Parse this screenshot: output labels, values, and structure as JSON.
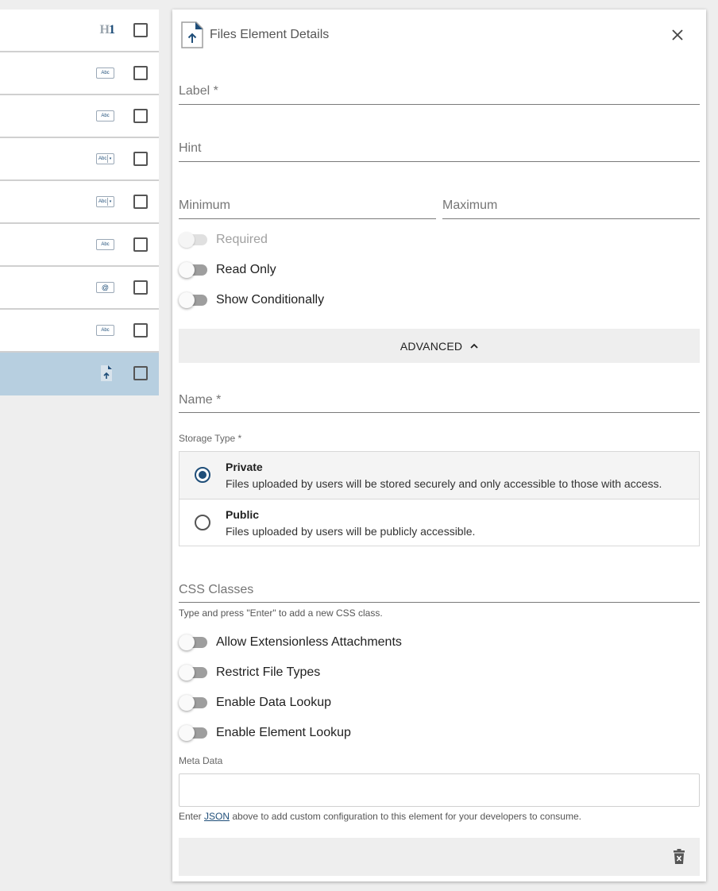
{
  "list": {
    "items": [
      {
        "icon": "heading-h1-icon",
        "selected": false
      },
      {
        "icon": "text-field-icon",
        "selected": false
      },
      {
        "icon": "text-field-icon",
        "selected": false
      },
      {
        "icon": "select-field-icon",
        "selected": false
      },
      {
        "icon": "select-field-icon",
        "selected": false
      },
      {
        "icon": "text-field-icon",
        "selected": false
      },
      {
        "icon": "email-field-icon",
        "selected": false
      },
      {
        "icon": "text-field-icon",
        "selected": false
      },
      {
        "icon": "file-upload-icon",
        "selected": true
      }
    ],
    "h1_icon_text_h": "H",
    "h1_icon_text_1": "1",
    "abc_text": "Abc",
    "email_glyph": "@"
  },
  "panel": {
    "title": "Files Element Details",
    "fields": {
      "label": "Label *",
      "hint": "Hint",
      "minimum": "Minimum",
      "maximum": "Maximum",
      "name": "Name *",
      "css_classes": "CSS Classes"
    },
    "toggles": {
      "required": "Required",
      "read_only": "Read Only",
      "show_conditionally": "Show Conditionally",
      "allow_extensionless": "Allow Extensionless Attachments",
      "restrict_file_types": "Restrict File Types",
      "enable_data_lookup": "Enable Data Lookup",
      "enable_element_lookup": "Enable Element Lookup"
    },
    "advanced_label": "ADVANCED",
    "storage_type": {
      "label": "Storage Type *",
      "options": [
        {
          "title": "Private",
          "description": "Files uploaded by users will be stored securely and only accessible to those with access.",
          "selected": true
        },
        {
          "title": "Public",
          "description": "Files uploaded by users will be publicly accessible.",
          "selected": false
        }
      ]
    },
    "css_hint": "Type and press \"Enter\" to add a new CSS class.",
    "meta_data": {
      "label": "Meta Data",
      "hint_before": "Enter ",
      "hint_link": "JSON",
      "hint_after": " above to add custom configuration to this element for your developers to consume."
    }
  },
  "colors": {
    "accent": "#1f4e79",
    "selected_row": "#b7cfe0",
    "toggle_track": "#9e9e9e"
  }
}
